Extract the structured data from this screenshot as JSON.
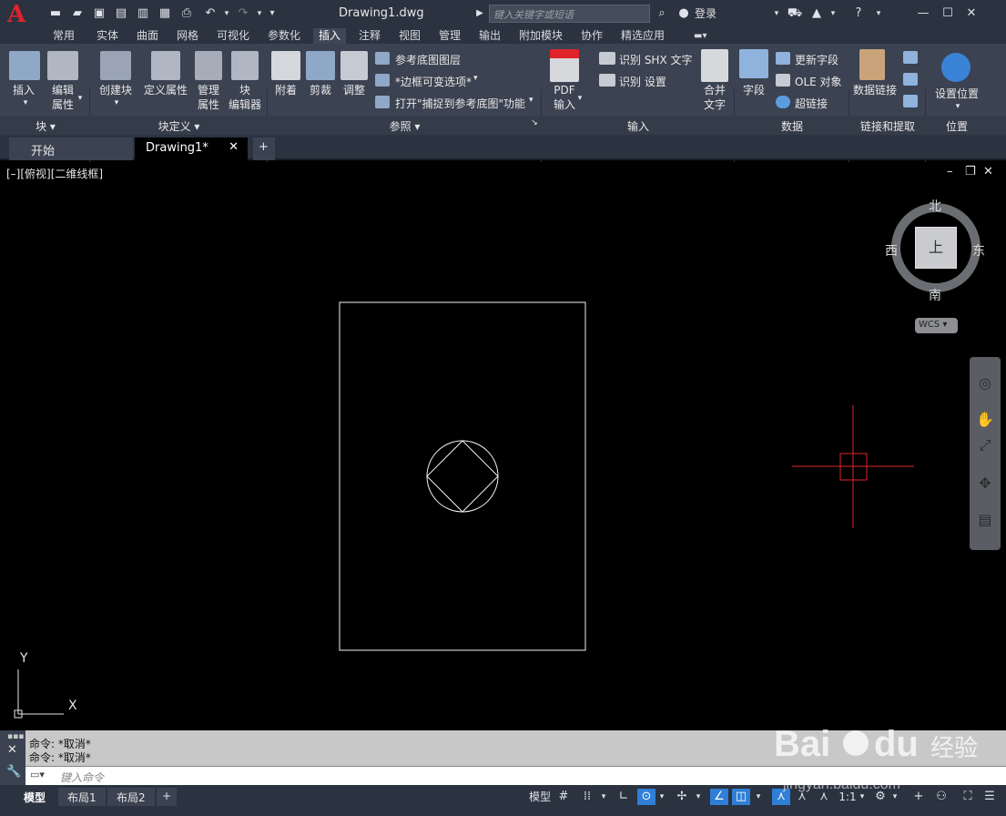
{
  "window": {
    "title": "Drawing1.dwg",
    "search_placeholder": "键入关键字或短语",
    "login": "登录",
    "logo_letter": "A"
  },
  "menu_tabs": [
    "常用",
    "实体",
    "曲面",
    "网格",
    "可视化",
    "参数化",
    "插入",
    "注释",
    "视图",
    "管理",
    "输出",
    "附加模块",
    "协作",
    "精选应用"
  ],
  "active_tab": "插入",
  "ribbon": {
    "block": {
      "insert": "插入",
      "edit_attr_1": "编辑",
      "edit_attr_2": "属性",
      "title": "块"
    },
    "block_def": {
      "create": "创建块",
      "define_attr": "定义属性",
      "manage_1": "管理",
      "manage_2": "属性",
      "block_editor_1": "块",
      "block_editor_2": "编辑器",
      "title": "块定义"
    },
    "reference": {
      "attach": "附着",
      "clip": "剪裁",
      "adjust": "调整",
      "underlay_layers": "参考底图图层",
      "frame_option": "*边框可变选项*",
      "snap_underlay": "打开\"捕捉到参考底图\"功能",
      "title": "参照"
    },
    "import": {
      "pdf_import_1": "PDF",
      "pdf_import_2": "输入",
      "recognize_shx": "识别 SHX 文字",
      "recognize_settings": "识别 设置",
      "combine_1": "合并",
      "combine_2": "文字",
      "title": "输入"
    },
    "data": {
      "field": "字段",
      "update_fields": "更新字段",
      "ole": "OLE 对象",
      "hyperlink": "超链接",
      "title": "数据"
    },
    "link_extract": {
      "data_link": "数据链接",
      "title": "链接和提取"
    },
    "location": {
      "set_location": "设置位置",
      "title": "位置"
    }
  },
  "doc_tabs": {
    "start": "开始",
    "drawing": "Drawing1*",
    "add": "+"
  },
  "viewport": {
    "label": "[–][俯视][二维线框]"
  },
  "viewcube": {
    "north": "北",
    "south": "南",
    "east": "东",
    "west": "西",
    "face": "上",
    "wcs": "WCS"
  },
  "ucs": {
    "x": "X",
    "y": "Y"
  },
  "command": {
    "line1": "命令: *取消*",
    "line2": "命令: *取消*",
    "placeholder": "键入命令"
  },
  "status": {
    "model": "模型",
    "layout1": "布局1",
    "layout2": "布局2",
    "add": "+",
    "model_btn": "模型",
    "scale": "1:1"
  },
  "colors": {
    "crosshair": "#e0232b",
    "accent": "#2f7fd6",
    "logo": "#e0232b"
  }
}
